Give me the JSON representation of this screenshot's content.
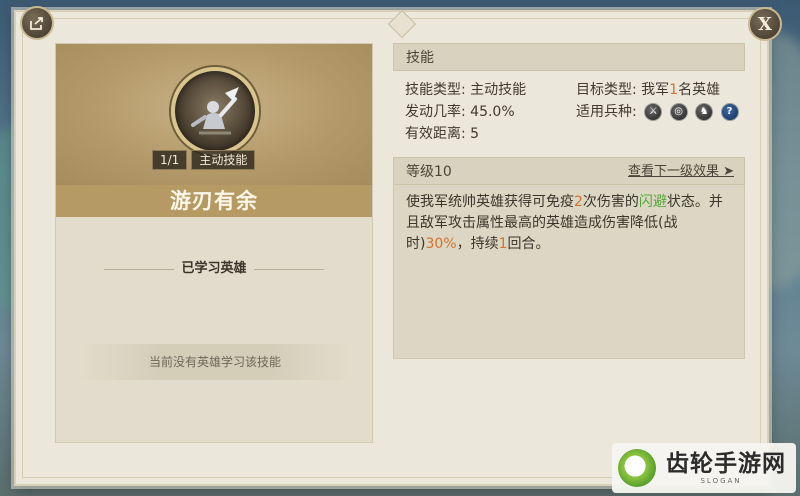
{
  "skill_card": {
    "count": "1/1",
    "type_badge": "主动技能",
    "name": "游刃有余",
    "learned_label": "已学习英雄",
    "no_hero_text": "当前没有英雄学习该技能"
  },
  "skill_section": {
    "header": "技能",
    "skill_type_label": "技能类型:",
    "skill_type_value": "主动技能",
    "target_type_label": "目标类型:",
    "target_prefix": "我军",
    "target_count": "1",
    "target_suffix": "名英雄",
    "trigger_rate_label": "发动几率:",
    "trigger_rate_value": "45.0%",
    "range_label": "有效距离:",
    "range_value": "5",
    "troop_label": "适用兵种:",
    "troop_icons": [
      "sword-icon",
      "target-icon",
      "horse-icon",
      "question-icon"
    ]
  },
  "level_section": {
    "level": "等级10",
    "next_link": "查看下一级效果 ➤",
    "desc": {
      "p1": "使我军统帅英雄获得可免疫",
      "n1": "2",
      "p2": "次伤害的",
      "status": "闪避",
      "p3": "状态。并且敌军攻击属性最高的英雄造成伤害降低(战时)",
      "pct": "30%",
      "p4": "，持续",
      "n2": "1",
      "p5": "回合。"
    }
  },
  "colors": {
    "highlight": "#d5722b",
    "status": "#56a83a",
    "name_bar": "#b59a63"
  },
  "watermark": {
    "title": "齿轮手游网",
    "sub": "SLOGAN"
  }
}
